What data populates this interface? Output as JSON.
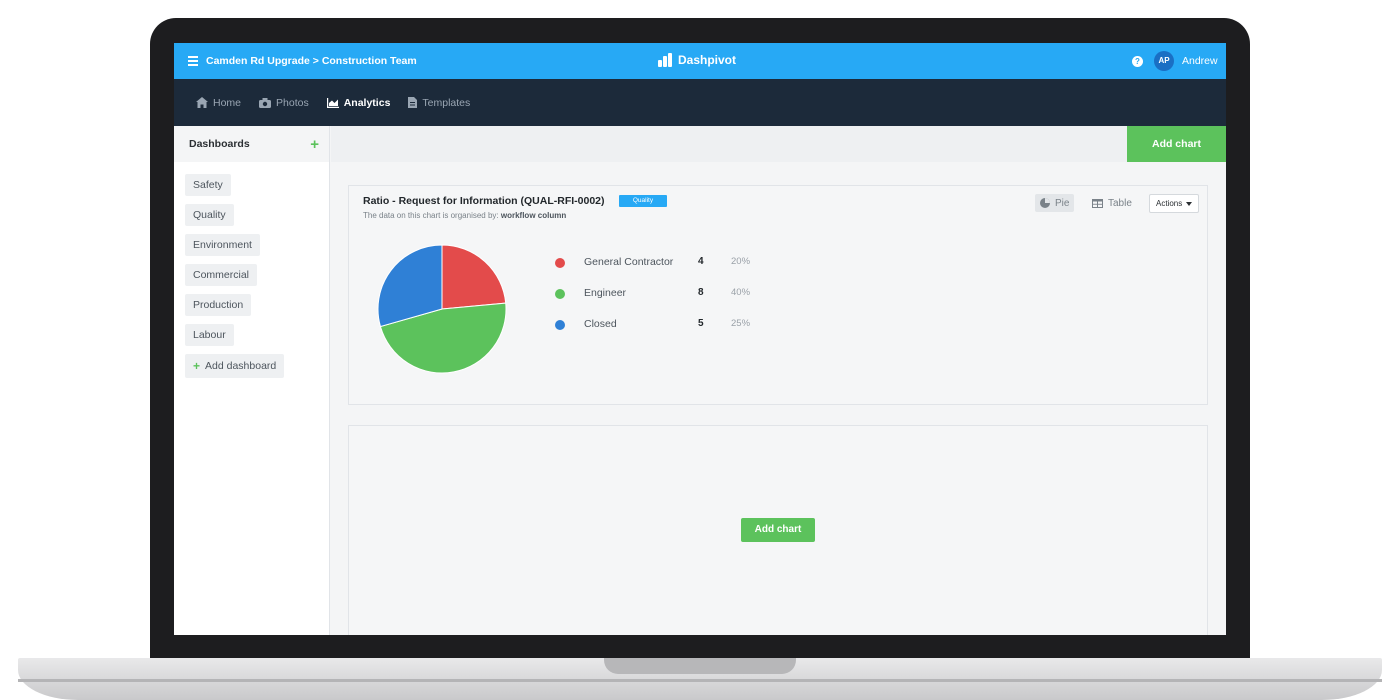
{
  "topbar": {
    "breadcrumb": "Camden Rd Upgrade > Construction Team",
    "brand": "Dashpivot",
    "avatar_initials": "AP",
    "username": "Andrew",
    "color": "#27a9f5"
  },
  "nav": {
    "items": [
      {
        "label": "Home",
        "icon": "home-icon"
      },
      {
        "label": "Photos",
        "icon": "camera-icon"
      },
      {
        "label": "Analytics",
        "icon": "chart-icon",
        "active": true
      },
      {
        "label": "Templates",
        "icon": "document-icon"
      }
    ]
  },
  "sidebar": {
    "title": "Dashboards",
    "items": [
      "Safety",
      "Quality",
      "Environment",
      "Commercial",
      "Production",
      "Labour"
    ],
    "add_label": "Add dashboard"
  },
  "main": {
    "add_chart_label": "Add chart"
  },
  "card": {
    "title": "Ratio - Request for Information (QUAL-RFI-0002)",
    "badge": "Quality",
    "subtitle_prefix": "The data on this chart is organised by:",
    "subtitle_value": "workflow column",
    "view_pie": "Pie",
    "view_table": "Table",
    "actions_label": "Actions"
  },
  "empty_card": {
    "add_chart_label": "Add chart"
  },
  "chart_data": {
    "type": "pie",
    "title": "Ratio - Request for Information (QUAL-RFI-0002)",
    "categories": [
      "General Contractor",
      "Engineer",
      "Closed"
    ],
    "values": [
      4,
      8,
      5
    ],
    "percent_labels": [
      "20%",
      "40%",
      "25%"
    ],
    "colors": [
      "#e34b4b",
      "#5cc25c",
      "#2f80d6"
    ],
    "legend_position": "right"
  }
}
